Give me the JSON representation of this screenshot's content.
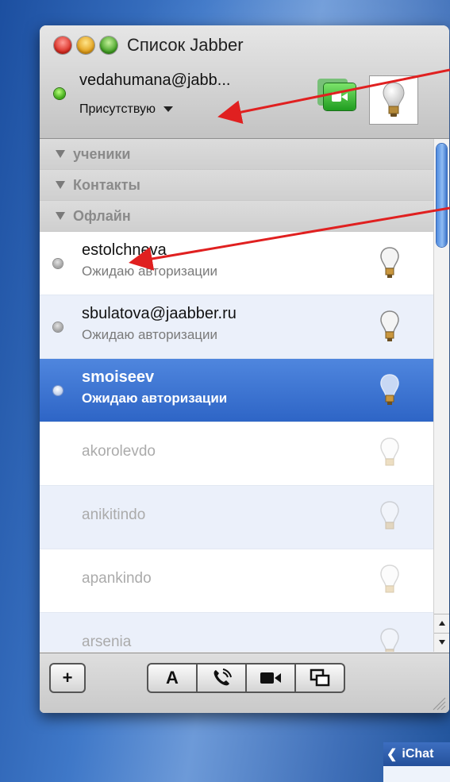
{
  "window": {
    "title": "Список Jabber"
  },
  "account": {
    "name": "vedahumana@jabb...",
    "presence": "Присутствую",
    "status_color": "#3aa414"
  },
  "groups": [
    {
      "label": "ученики"
    },
    {
      "label": "Контакты"
    },
    {
      "label": "Офлайн"
    }
  ],
  "contacts": [
    {
      "name": "estolchneva",
      "status": "Ожидаю авторизации",
      "selected": false
    },
    {
      "name": "sbulatova@jaabber.ru",
      "status": "Ожидаю авторизации",
      "selected": false
    },
    {
      "name": "smoiseev",
      "status": "Ожидаю авторизации",
      "selected": true
    },
    {
      "name": "akorolevdo",
      "status": "",
      "selected": false
    },
    {
      "name": "anikitindo",
      "status": "",
      "selected": false
    },
    {
      "name": "apankindo",
      "status": "",
      "selected": false
    },
    {
      "name": "arsenia",
      "status": "",
      "selected": false
    }
  ],
  "toolbar": {
    "add_label": "+",
    "text_chat_label": "A"
  },
  "dock": {
    "app_label": "iChat"
  },
  "colors": {
    "selection": "#2e65c6",
    "annotation_arrow": "#e02020"
  }
}
